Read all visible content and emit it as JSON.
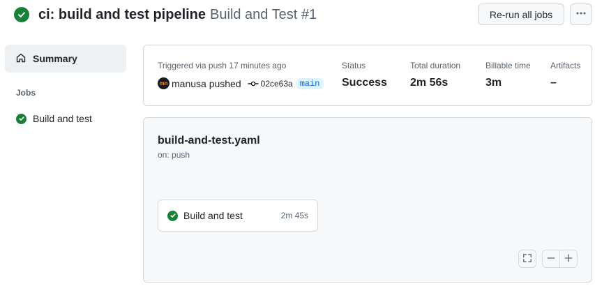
{
  "header": {
    "workflow_name": "ci: build and test pipeline",
    "run_name": "Build and Test #1",
    "rerun_label": "Re-run all jobs",
    "more_label": "···"
  },
  "sidebar": {
    "summary_label": "Summary",
    "jobs_heading": "Jobs",
    "jobs": [
      {
        "label": "Build and test",
        "status": "success"
      }
    ]
  },
  "summary": {
    "trigger_text": "Triggered via push 17 minutes ago",
    "actor_initials": "mn",
    "actor_text": "manusa pushed",
    "commit_sha": "02ce63a",
    "branch": "main",
    "status_label": "Status",
    "status_value": "Success",
    "duration_label": "Total duration",
    "duration_value": "2m 56s",
    "billable_label": "Billable time",
    "billable_value": "3m",
    "artifacts_label": "Artifacts",
    "artifacts_value": "–"
  },
  "graph": {
    "file_name": "build-and-test.yaml",
    "trigger": "on: push",
    "job": {
      "label": "Build and test",
      "duration": "2m 45s"
    }
  },
  "colors": {
    "success": "#1a7f37",
    "branch_bg": "#ddf4ff",
    "branch_fg": "#0969da",
    "muted": "#59636e",
    "border": "#d1d9e0"
  },
  "icons": {
    "status": "check-circle-fill-icon",
    "summary": "home-icon",
    "commit": "git-commit-icon",
    "more": "kebab-horizontal-icon",
    "fullscreen": "screen-full-icon",
    "zoom_out": "dash-icon",
    "zoom_in": "plus-icon"
  }
}
